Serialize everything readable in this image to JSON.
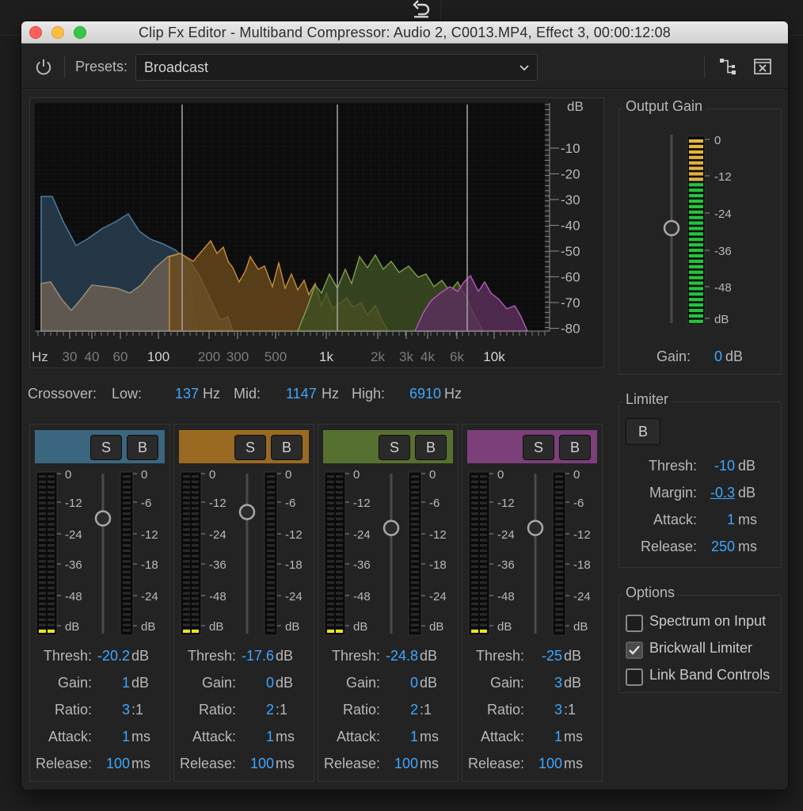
{
  "window": {
    "title": "Clip Fx Editor - Multiband Compressor: Audio 2, C0013.MP4, Effect 3, 00:00:12:08"
  },
  "toolbar": {
    "presets_label": "Presets:",
    "preset_value": "Broadcast"
  },
  "spectrum": {
    "db_unit": "dB",
    "db_ticks": [
      "-10",
      "-20",
      "-30",
      "-40",
      "-50",
      "-60",
      "-70",
      "-80"
    ],
    "hz_unit": "Hz",
    "hz_ticks": [
      "30",
      "40",
      "60",
      "100",
      "200",
      "300",
      "500",
      "1k",
      "2k",
      "3k",
      "4k",
      "6k",
      "10k"
    ]
  },
  "crossover": {
    "label": "Crossover:",
    "low_label": "Low:",
    "low_value": "137",
    "low_unit": "Hz",
    "mid_label": "Mid:",
    "mid_value": "1147",
    "mid_unit": "Hz",
    "high_label": "High:",
    "high_value": "6910",
    "high_unit": "Hz"
  },
  "band_meter_labels": {
    "left": [
      "0",
      "-12",
      "-24",
      "-36",
      "-48",
      "dB"
    ],
    "right": [
      "0",
      "-6",
      "-12",
      "-18",
      "-24",
      "dB"
    ]
  },
  "bands": [
    {
      "color": "#3b6680",
      "solo": "S",
      "bypass": "B",
      "thresh_label": "Thresh:",
      "thresh": "-20.2",
      "thresh_unit": "dB",
      "gain_label": "Gain:",
      "gain": "1",
      "gain_unit": "dB",
      "ratio_label": "Ratio:",
      "ratio": "3",
      "ratio_unit": ":1",
      "attack_label": "Attack:",
      "attack": "1",
      "attack_unit": "ms",
      "release_label": "Release:",
      "release": "100",
      "release_unit": "ms"
    },
    {
      "color": "#9a6a22",
      "solo": "S",
      "bypass": "B",
      "thresh_label": "Thresh:",
      "thresh": "-17.6",
      "thresh_unit": "dB",
      "gain_label": "Gain:",
      "gain": "0",
      "gain_unit": "dB",
      "ratio_label": "Ratio:",
      "ratio": "2",
      "ratio_unit": ":1",
      "attack_label": "Attack:",
      "attack": "1",
      "attack_unit": "ms",
      "release_label": "Release:",
      "release": "100",
      "release_unit": "ms"
    },
    {
      "color": "#56702f",
      "solo": "S",
      "bypass": "B",
      "thresh_label": "Thresh:",
      "thresh": "-24.8",
      "thresh_unit": "dB",
      "gain_label": "Gain:",
      "gain": "0",
      "gain_unit": "dB",
      "ratio_label": "Ratio:",
      "ratio": "2",
      "ratio_unit": ":1",
      "attack_label": "Attack:",
      "attack": "1",
      "attack_unit": "ms",
      "release_label": "Release:",
      "release": "100",
      "release_unit": "ms"
    },
    {
      "color": "#7c3f7a",
      "solo": "S",
      "bypass": "B",
      "thresh_label": "Thresh:",
      "thresh": "-25",
      "thresh_unit": "dB",
      "gain_label": "Gain:",
      "gain": "3",
      "gain_unit": "dB",
      "ratio_label": "Ratio:",
      "ratio": "3",
      "ratio_unit": ":1",
      "attack_label": "Attack:",
      "attack": "1",
      "attack_unit": "ms",
      "release_label": "Release:",
      "release": "100",
      "release_unit": "ms"
    }
  ],
  "output_gain": {
    "title": "Output Gain",
    "meter_labels": [
      "0",
      "-12",
      "-24",
      "-36",
      "-48",
      "dB"
    ],
    "gain_label": "Gain:",
    "gain_value": "0",
    "gain_unit": "dB"
  },
  "limiter": {
    "title": "Limiter",
    "bypass": "B",
    "thresh_label": "Thresh:",
    "thresh": "-10",
    "thresh_unit": "dB",
    "margin_label": "Margin:",
    "margin": "-0.3",
    "margin_unit": "dB",
    "attack_label": "Attack:",
    "attack": "1",
    "attack_unit": "ms",
    "release_label": "Release:",
    "release": "250",
    "release_unit": "ms"
  },
  "options": {
    "title": "Options",
    "items": [
      {
        "label": "Spectrum on Input",
        "checked": false
      },
      {
        "label": "Brickwall Limiter",
        "checked": true
      },
      {
        "label": "Link Band Controls",
        "checked": false
      }
    ]
  },
  "icons": {
    "power": "power-icon",
    "chevron": "chevron-down-icon",
    "route": "routing-icon",
    "close": "close-box-icon",
    "undo": "undo-icon"
  }
}
